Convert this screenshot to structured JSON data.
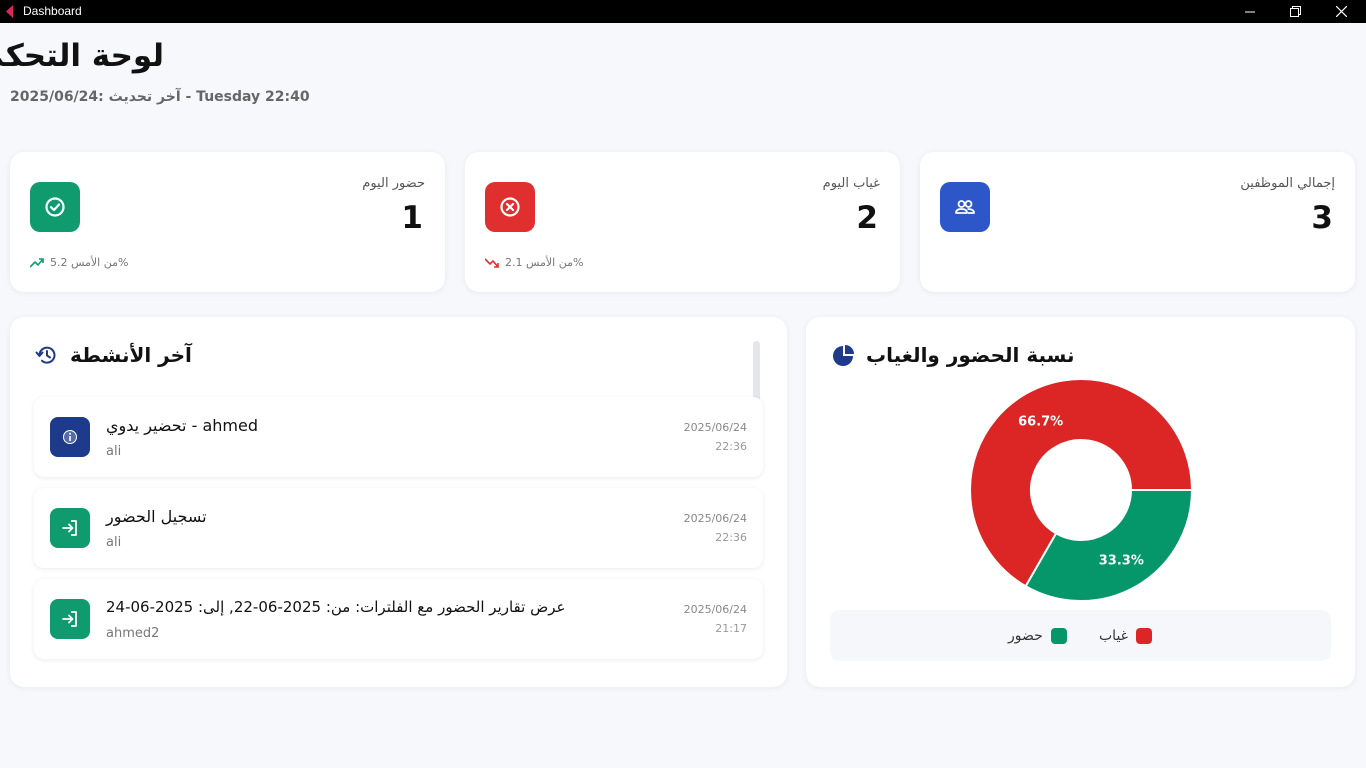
{
  "window": {
    "title": "Dashboard"
  },
  "header": {
    "title": "لوحة التحكم",
    "subtitle": "2025/06/24: آخر تحديث - Tuesday 22:40"
  },
  "stats": [
    {
      "label": "حضور اليوم",
      "value": "1",
      "trend": "من الأمس 5.2%",
      "trend_dir": "up",
      "color": "#0f9b6e",
      "icon": "check-circle-icon"
    },
    {
      "label": "غياب اليوم",
      "value": "2",
      "trend": "من الأمس 2.1%",
      "trend_dir": "down",
      "color": "#e02f2f",
      "icon": "x-circle-icon"
    },
    {
      "label": "إجمالي الموظفين",
      "value": "3",
      "trend": "",
      "color": "#2d56c9",
      "icon": "users-icon"
    }
  ],
  "activity": {
    "title": "آخر الأنشطة",
    "items": [
      {
        "title": "تحضير يدوي - ahmed",
        "user": "ali",
        "date": "2025/06/24",
        "time": "22:36",
        "icon": "info-icon",
        "color": "#1e3a8a"
      },
      {
        "title": "تسجيل الحضور",
        "user": "ali",
        "date": "2025/06/24",
        "time": "22:36",
        "icon": "login-icon",
        "color": "#0f9b6e"
      },
      {
        "title": "عرض تقارير الحضور مع الفلترات: من: 2025-06-22, إلى: 2025-06-24",
        "user": "ahmed2",
        "date": "2025/06/24",
        "time": "21:17",
        "icon": "login-icon",
        "color": "#0f9b6e"
      }
    ]
  },
  "chart_panel": {
    "title": "نسبة الحضور والغياب"
  },
  "chart_data": {
    "type": "pie",
    "donut": true,
    "labels": [
      "غياب",
      "حضور"
    ],
    "values": [
      66.7,
      33.3
    ],
    "data_labels": [
      "66.7%",
      "33.3%"
    ],
    "colors": [
      "#dc2626",
      "#059669"
    ],
    "legend_position": "bottom"
  }
}
